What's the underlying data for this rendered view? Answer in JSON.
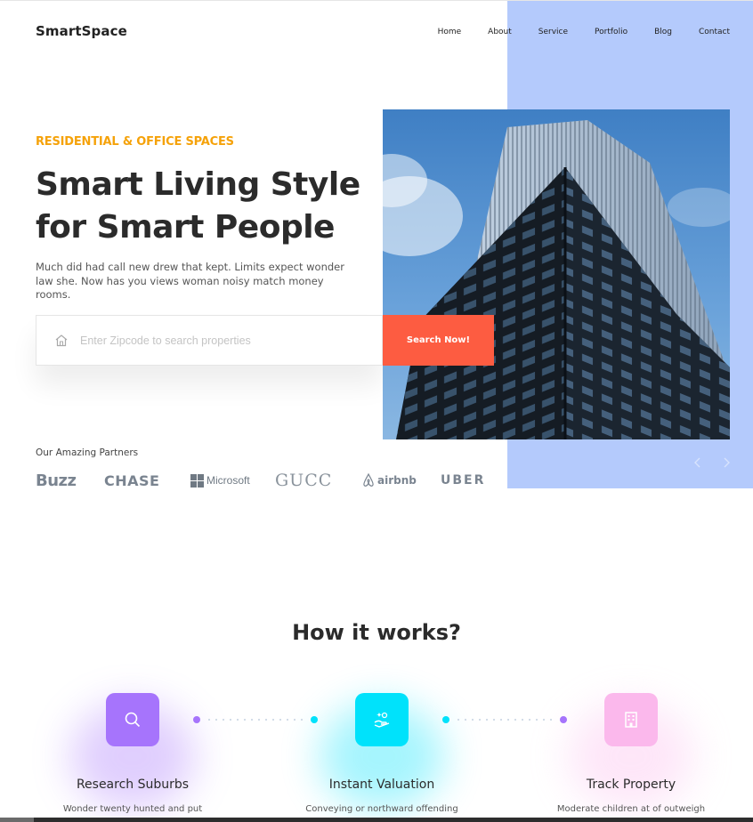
{
  "header": {
    "brand": "SmartSpace",
    "nav": [
      "Home",
      "About",
      "Service",
      "Portfolio",
      "Blog",
      "Contact"
    ]
  },
  "hero": {
    "eyebrow": "RESIDENTIAL & OFFICE SPACES",
    "title_line1": "Smart Living Style",
    "title_line2": "for Smart People",
    "description": "Much did had call new drew that kept. Limits expect wonder law she. Now has you views woman noisy match money rooms.",
    "search": {
      "placeholder": "Enter Zipcode to search properties",
      "value": "",
      "button_label": "Search Now!"
    }
  },
  "partners": {
    "label": "Our Amazing Partners",
    "logos": [
      "Buzz",
      "CHASE",
      "Microsoft",
      "GUCC",
      "airbnb",
      "UBER"
    ]
  },
  "how_it_works": {
    "title": "How it works?",
    "steps": [
      {
        "title": "Research Suburbs",
        "description": "Wonder twenty hunted and put",
        "icon": "search-icon",
        "color": "#a674fc"
      },
      {
        "title": "Instant Valuation",
        "description": "Conveying or northward offending",
        "icon": "hand-coin-icon",
        "color": "#00e2fb"
      },
      {
        "title": "Track Property",
        "description": "Moderate children at of outweigh",
        "icon": "building-icon",
        "color": "#fbb8ec"
      }
    ]
  },
  "colors": {
    "accent_orange": "#f5a20a",
    "button_red": "#fd5c41",
    "panel_blue": "#b4cafc",
    "dot_purple": "#a674fc",
    "dot_cyan": "#00e2fb"
  }
}
